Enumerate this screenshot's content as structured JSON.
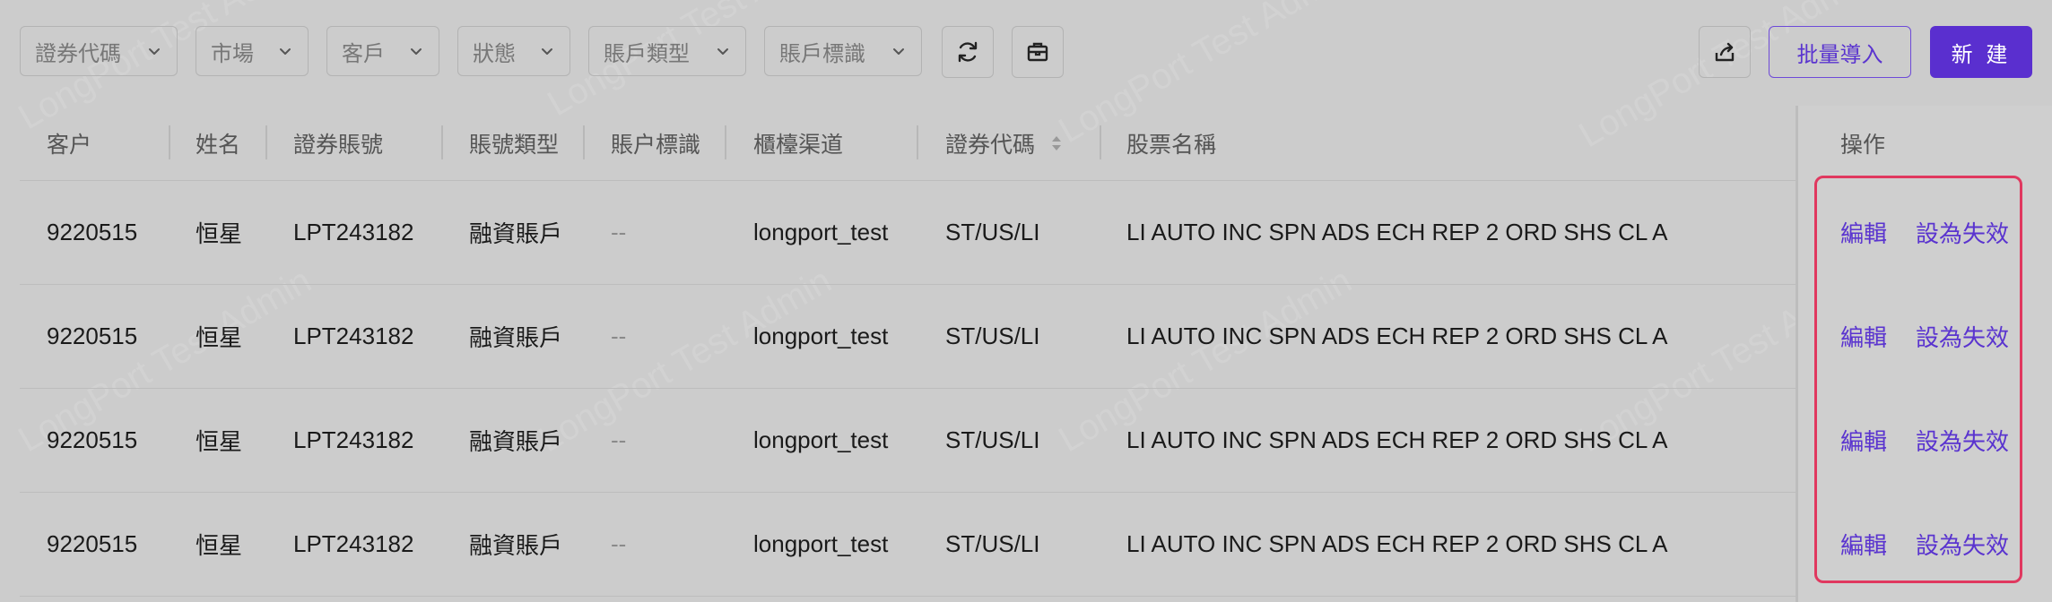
{
  "filters": [
    {
      "label": "證券代碼"
    },
    {
      "label": "市場"
    },
    {
      "label": "客戶"
    },
    {
      "label": "狀態"
    },
    {
      "label": "賬戶類型"
    },
    {
      "label": "賬戶標識"
    }
  ],
  "toolbar": {
    "refresh_icon": "refresh-icon",
    "briefcase_icon": "briefcase-icon",
    "export_icon": "export-icon",
    "bulk_import_label": "批量導入",
    "create_label": "新 建"
  },
  "table": {
    "columns": [
      "客户",
      "姓名",
      "證券賬號",
      "賬號類型",
      "賬户標識",
      "櫃檯渠道",
      "證券代碼",
      "股票名稱"
    ],
    "ops_header": "操作",
    "rows": [
      {
        "customer": "9220515",
        "name": "恒星",
        "account": "LPT243182",
        "account_type": "融資賬戶",
        "account_flag": "--",
        "channel": "longport_test",
        "code": "ST/US/LI",
        "stock_name": "LI AUTO INC SPN ADS ECH REP 2 ORD SHS CL A",
        "edit": "編輯",
        "deactivate": "設為失效"
      },
      {
        "customer": "9220515",
        "name": "恒星",
        "account": "LPT243182",
        "account_type": "融資賬戶",
        "account_flag": "--",
        "channel": "longport_test",
        "code": "ST/US/LI",
        "stock_name": "LI AUTO INC SPN ADS ECH REP 2 ORD SHS CL A",
        "edit": "編輯",
        "deactivate": "設為失效"
      },
      {
        "customer": "9220515",
        "name": "恒星",
        "account": "LPT243182",
        "account_type": "融資賬戶",
        "account_flag": "--",
        "channel": "longport_test",
        "code": "ST/US/LI",
        "stock_name": "LI AUTO INC SPN ADS ECH REP 2 ORD SHS CL A",
        "edit": "編輯",
        "deactivate": "設為失效"
      },
      {
        "customer": "9220515",
        "name": "恒星",
        "account": "LPT243182",
        "account_type": "融資賬戶",
        "account_flag": "--",
        "channel": "longport_test",
        "code": "ST/US/LI",
        "stock_name": "LI AUTO INC SPN ADS ECH REP 2 ORD SHS CL A",
        "edit": "編輯",
        "deactivate": "設為失效"
      }
    ]
  },
  "watermark": "LongPort Test Admin",
  "colors": {
    "accent": "#5a2fcf",
    "highlight_border": "#e0385f",
    "background": "#cccccc"
  }
}
